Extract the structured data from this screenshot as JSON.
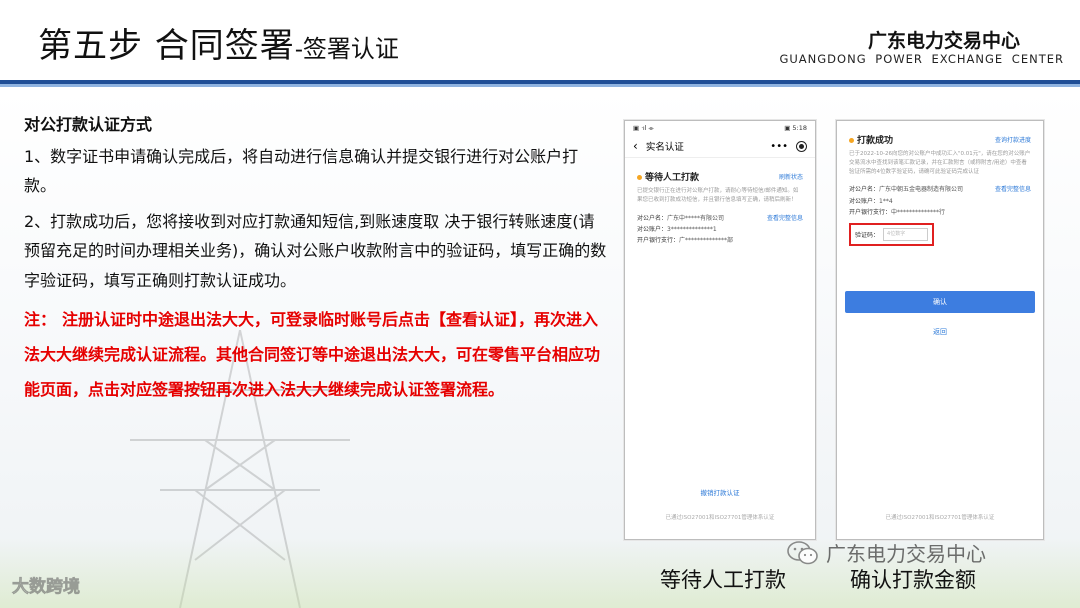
{
  "header": {
    "title_main": "第五步 合同签署",
    "title_sub": "-签署认证",
    "org_cn": "广东电力交易中心",
    "org_en": "GUANGDONG POWER EXCHANGE CENTER"
  },
  "content": {
    "heading": "对公打款认证方式",
    "para1": "1、数字证书申请确认完成后，将自动进行信息确认并提交银行进行对公账户打款。",
    "para2": "2、打款成功后，您将接收到对应打款通知短信,到账速度取 决于银行转账速度(请预留充足的时间办理相关业务)，确认对公账户收款附言中的验证码，填写正确的数字验证码，填写正确则打款认证成功。",
    "note_label": "注：",
    "note_text": "注册认证时中途退出法大大，可登录临时账号后点击【查看认证】，再次进入法大大继续完成认证流程。其他合同签订等中途退出法大大，可在零售平台相应功能页面，点击对应签署按钮再次进入法大大继续完成认证签署流程。"
  },
  "phone1": {
    "status_left": "▣ ᐧıl ⌯",
    "status_right": "▣ 5:18",
    "nav_title": "实名认证",
    "nav_more": "•••",
    "card_title": "等待人工打款",
    "card_link": "刷新状态",
    "desc": "已提交银行正在进行对公账户打款，请耐心等待短信/邮件通知。如果您已收到打款成功短信，并且银行信息填写正确，请稍后刷新！",
    "fields": [
      {
        "k": "对公户名：",
        "v": "广东中*****有限公司"
      },
      {
        "k": "对公账户：",
        "v": "3**************1"
      },
      {
        "k": "开户银行支行：",
        "v": "广**************部"
      }
    ],
    "view_info": "查看完整信息",
    "cancel": "撤销打款认证",
    "footer": "已通过ISO27001和ISO27701管理体系认证"
  },
  "phone2": {
    "card_title": "打款成功",
    "card_link": "查询打款进度",
    "desc": "已于2022-10-26向您的对公账户中成功汇入\"0.01元\"，请在您的对公账户交易流水中查找到该笔汇款记录，并在汇款附言（或称附言/用途）中查看验证所需的4位数字验证码，请确可此验证码完成认证",
    "fields": [
      {
        "k": "对公户名：",
        "v": "广东中朝五金电器制造有限公司"
      },
      {
        "k": "对公账户：",
        "v": "1**4"
      },
      {
        "k": "开户银行支行：",
        "v": "中**************行"
      }
    ],
    "view_info": "查看完整信息",
    "verify_label": "验证码：",
    "verify_placeholder": "4位数字",
    "confirm": "确认",
    "back": "返回",
    "footer": "已通过ISO27001和ISO27701管理体系认证"
  },
  "captions": {
    "left": "等待人工打款",
    "right": "确认打款金额"
  },
  "watermarks": {
    "right": "广东电力交易中心",
    "left": "大数跨境"
  }
}
